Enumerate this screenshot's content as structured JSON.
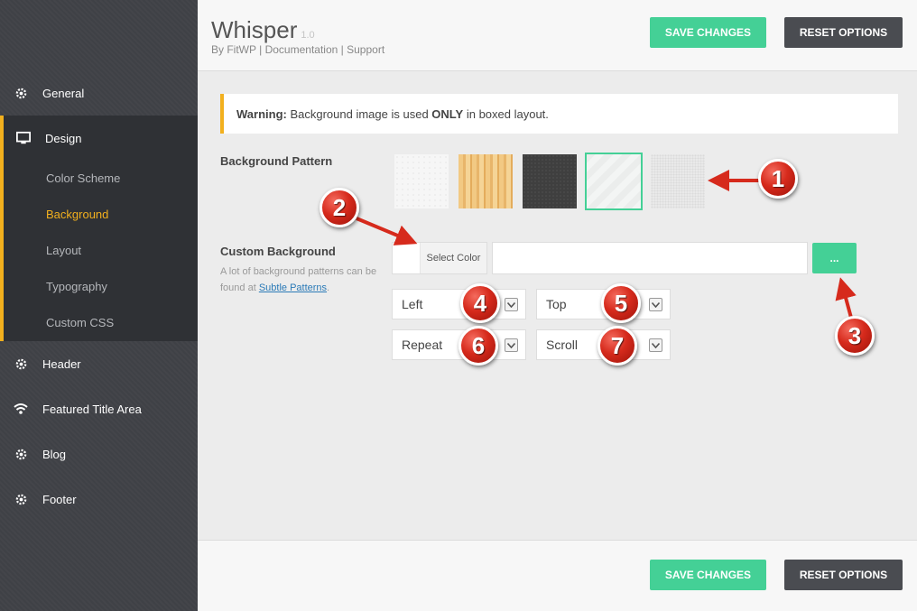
{
  "app": {
    "title": "Whisper",
    "version": "1.0",
    "by_prefix": "By FitWP",
    "links": [
      "Documentation",
      "Support"
    ],
    "separator": "|"
  },
  "buttons": {
    "save": "SAVE CHANGES",
    "reset": "RESET OPTIONS",
    "browse": "..."
  },
  "sidebar": {
    "items": [
      {
        "label": "General",
        "icon": "gear-icon"
      },
      {
        "label": "Design",
        "icon": "monitor-icon"
      },
      {
        "label": "Header",
        "icon": "gear-icon"
      },
      {
        "label": "Featured Title Area",
        "icon": "wifi-icon"
      },
      {
        "label": "Blog",
        "icon": "gear-icon"
      },
      {
        "label": "Footer",
        "icon": "gear-icon"
      }
    ],
    "design_subitems": [
      "Color Scheme",
      "Background",
      "Layout",
      "Typography",
      "Custom CSS"
    ],
    "active_subitem": "Background"
  },
  "warning": {
    "prefix": "Warning:",
    "text1": "Background image is used",
    "emphasis": "ONLY",
    "text2": "in boxed layout."
  },
  "background_pattern": {
    "label": "Background Pattern",
    "selected_index": 3
  },
  "custom_background": {
    "label": "Custom Background",
    "desc_prefix": "A lot of background patterns can be found at",
    "link": "Subtle Patterns",
    "desc_suffix": ".",
    "color_button": "Select Color",
    "url_value": ""
  },
  "selects": {
    "position_x": "Left",
    "position_y": "Top",
    "repeat": "Repeat",
    "attachment": "Scroll"
  },
  "annotations": [
    "1",
    "2",
    "3",
    "4",
    "5",
    "6",
    "7"
  ],
  "colors": {
    "accent_green": "#44d096",
    "accent_yellow": "#f2b01e",
    "sidebar_bg": "#3f4146",
    "badge_red": "#d62a1c"
  }
}
